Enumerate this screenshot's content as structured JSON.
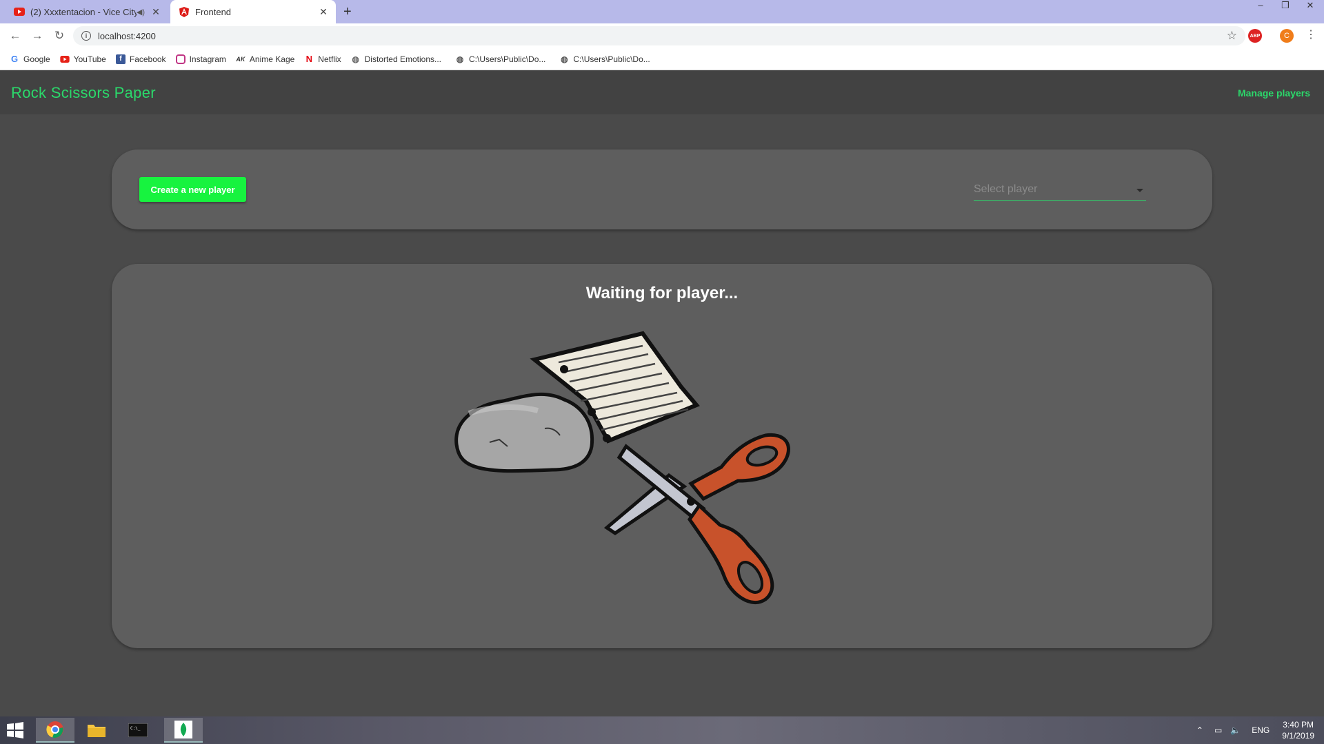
{
  "browser": {
    "tabs": [
      {
        "title": "(2) Xxxtentacion - Vice City -",
        "favicon": "youtube-icon",
        "active": false
      },
      {
        "title": "Frontend",
        "favicon": "angular-icon",
        "active": true
      }
    ],
    "address": "localhost:4200",
    "bookmarks": [
      {
        "label": "Google",
        "icon": "google-icon"
      },
      {
        "label": "YouTube",
        "icon": "youtube-icon"
      },
      {
        "label": "Facebook",
        "icon": "facebook-icon"
      },
      {
        "label": "Instagram",
        "icon": "instagram-icon"
      },
      {
        "label": "Anime Kage",
        "icon": "animekage-icon"
      },
      {
        "label": "Netflix",
        "icon": "netflix-icon"
      },
      {
        "label": "Distorted Emotions...",
        "icon": "globe-icon"
      },
      {
        "label": "C:\\Users\\Public\\Do...",
        "icon": "globe-icon"
      },
      {
        "label": "C:\\Users\\Public\\Do...",
        "icon": "globe-icon"
      }
    ],
    "profile_initial": "C",
    "abp_label": "ABP"
  },
  "app": {
    "title": "Rock Scissors Paper",
    "manage_players": "Manage players",
    "create_button": "Create a new player",
    "select_placeholder": "Select player",
    "status": "Waiting for player..."
  },
  "taskbar": {
    "lang": "ENG",
    "time": "3:40 PM",
    "date": "9/1/2019"
  },
  "colors": {
    "accent": "#2bd96b",
    "button": "#17f33f",
    "header": "#424242",
    "card": "#5e5e5e",
    "background": "#4a4a4a"
  }
}
